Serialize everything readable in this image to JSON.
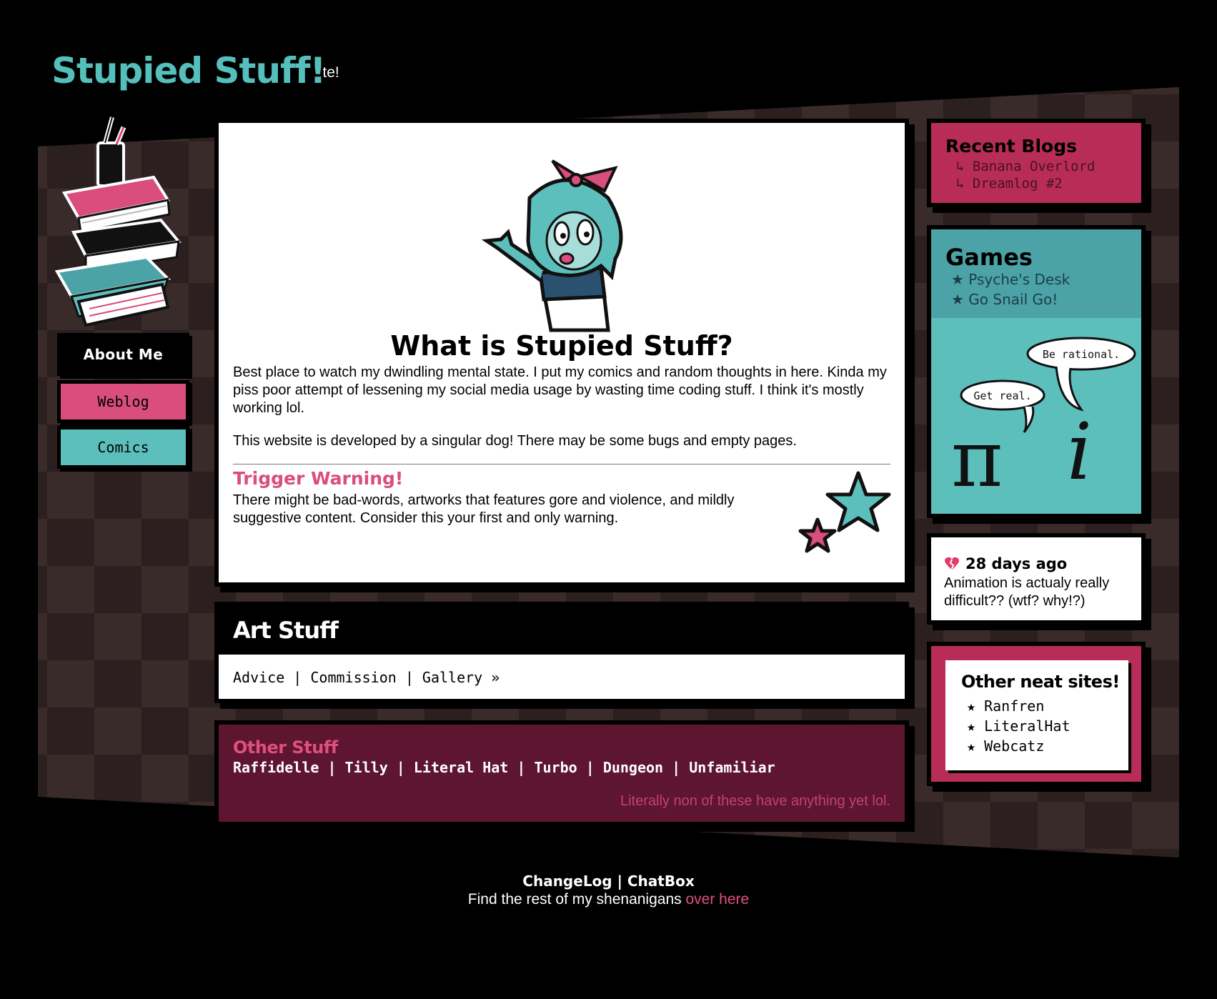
{
  "header": {
    "title": "Stupied Stuff!",
    "marquee": "A stupid little website!"
  },
  "nav": {
    "about": "About Me",
    "weblog": "Weblog",
    "comics": "Comics"
  },
  "main": {
    "title": "What is Stupied Stuff?",
    "p1": "Best place to watch my dwindling mental state. I put my comics and random thoughts in here. Kinda my piss poor attempt of lessening my social media usage by wasting time coding stuff. I think it's mostly working lol.",
    "p2": "This website is developed by a singular dog! There may be some bugs and empty pages.",
    "warning_title": "Trigger Warning!",
    "warning_text": "There might be bad-words, artworks that features gore and violence, and mildly suggestive content. Consider this your first and only warning."
  },
  "art": {
    "title": "Art Stuff",
    "links": [
      "Advice",
      "Commission",
      "Gallery"
    ],
    "separator": " | ",
    "more": " »"
  },
  "other": {
    "title": "Other Stuff",
    "links": [
      "Raffidelle",
      "Tilly",
      "Literal Hat",
      "Turbo",
      "Dungeon",
      "Unfamiliar"
    ],
    "separator": " | ",
    "note": "Literally non of these have anything yet lol."
  },
  "blogs": {
    "title": "Recent Blogs",
    "items": [
      "↳ Banana Overlord",
      "↳ Dreamlog #2"
    ]
  },
  "games": {
    "title": "Games",
    "items": [
      "★ Psyche's Desk",
      "★ Go Snail Go!"
    ],
    "bubble_left": "Get real.",
    "bubble_right": "Be rational."
  },
  "status": {
    "time": "28 days ago",
    "text": "Animation is actualy really difficult?? (wtf? why!?)"
  },
  "neat": {
    "title": "Other neat sites!",
    "items": [
      "★ Ranfren",
      "★ LiteralHat",
      "★ Webcatz"
    ]
  },
  "footer": {
    "changelog": "ChangeLog",
    "sep": " | ",
    "chatbox": "ChatBox",
    "line": "Find the rest of my shenanigans ",
    "link": "over here"
  },
  "colors": {
    "teal": "#5dbfbc",
    "pink": "#d94e7c",
    "crimson": "#b72d58",
    "wine": "#5e1530"
  }
}
